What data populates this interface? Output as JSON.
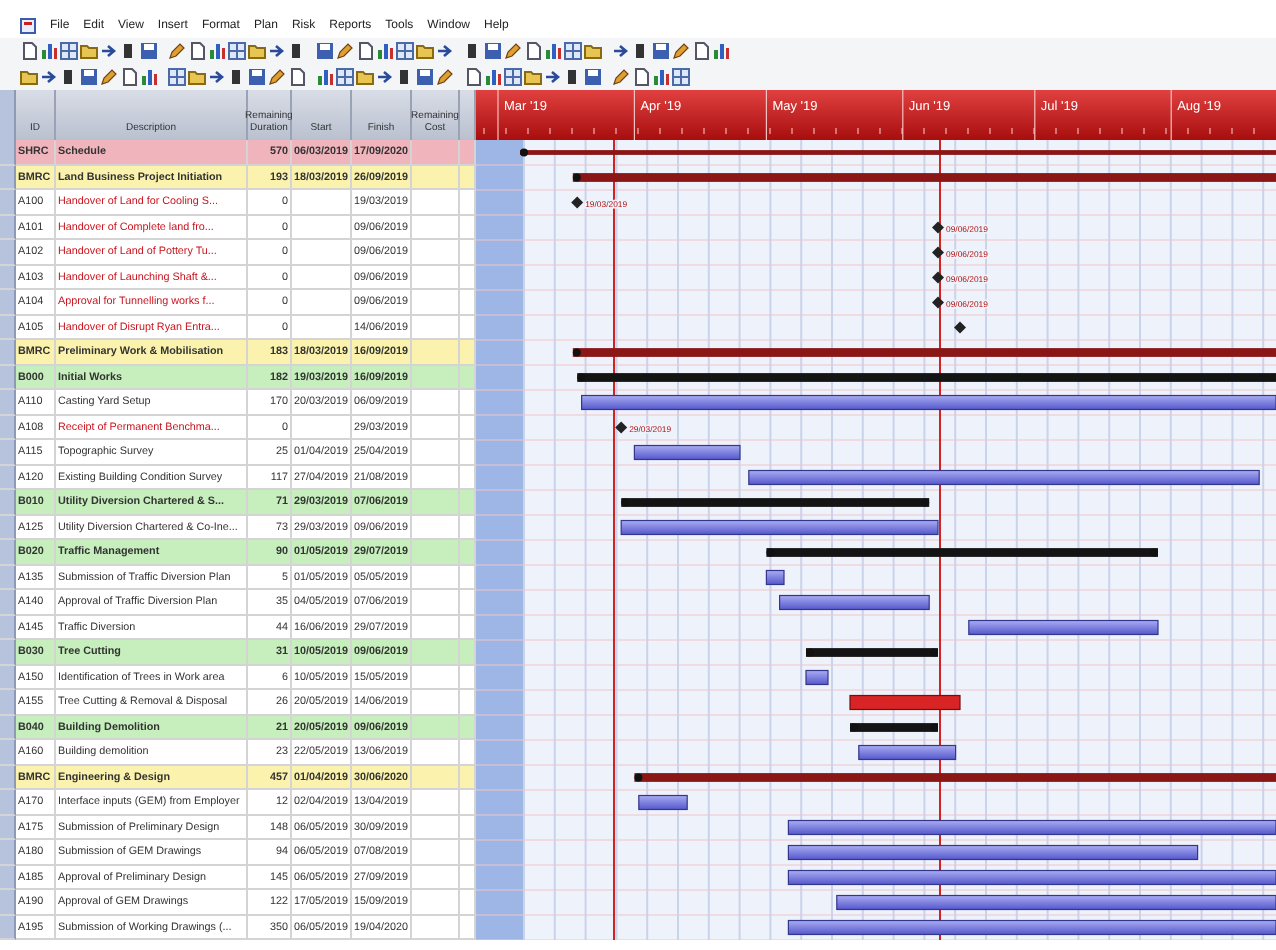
{
  "menu": [
    "File",
    "Edit",
    "View",
    "Insert",
    "Format",
    "Plan",
    "Risk",
    "Reports",
    "Tools",
    "Window",
    "Help"
  ],
  "columns": [
    "ID",
    "Description",
    "Remaining Duration",
    "Start",
    "Finish",
    "Remaining Cost"
  ],
  "timeline": {
    "months": [
      "Mar '19",
      "Apr '19",
      "May '19",
      "Jun '19",
      "Jul '19",
      "Aug '19"
    ]
  },
  "rows": [
    {
      "kind": "project",
      "id": "SHRC",
      "description": "Schedule",
      "duration": "570",
      "start": "06/03/2019",
      "finish": "17/09/2020"
    },
    {
      "kind": "phase",
      "id": "BMRC",
      "description": "Land Business Project Initiation",
      "duration": "193",
      "start": "18/03/2019",
      "finish": "26/09/2019"
    },
    {
      "kind": "milestone",
      "id": "A100",
      "description": "Handover of Land for Cooling S...",
      "duration": "0",
      "finish": "19/03/2019",
      "milestone_label": "19/03/2019"
    },
    {
      "kind": "milestone",
      "id": "A101",
      "description": "Handover of Complete land fro...",
      "duration": "0",
      "finish": "09/06/2019",
      "milestone_label": "09/06/2019"
    },
    {
      "kind": "milestone",
      "id": "A102",
      "description": "Handover of Land of Pottery Tu...",
      "duration": "0",
      "finish": "09/06/2019",
      "milestone_label": "09/06/2019"
    },
    {
      "kind": "milestone",
      "id": "A103",
      "description": "Handover of Launching Shaft &...",
      "duration": "0",
      "finish": "09/06/2019",
      "milestone_label": "09/06/2019"
    },
    {
      "kind": "milestone",
      "id": "A104",
      "description": "Approval for Tunnelling works f...",
      "duration": "0",
      "finish": "09/06/2019",
      "milestone_label": "09/06/2019"
    },
    {
      "kind": "milestone",
      "id": "A105",
      "description": "Handover of Disrupt Ryan Entra...",
      "duration": "0",
      "finish": "14/06/2019"
    },
    {
      "kind": "phase",
      "id": "BMRC",
      "description": "Preliminary Work & Mobilisation",
      "duration": "183",
      "start": "18/03/2019",
      "finish": "16/09/2019"
    },
    {
      "kind": "group",
      "id": "B000",
      "description": "Initial Works",
      "duration": "182",
      "start": "19/03/2019",
      "finish": "16/09/2019"
    },
    {
      "kind": "task",
      "id": "A110",
      "description": "Casting Yard Setup",
      "duration": "170",
      "start": "20/03/2019",
      "finish": "06/09/2019"
    },
    {
      "kind": "milestone",
      "id": "A108",
      "description": "Receipt of Permanent Benchma...",
      "duration": "0",
      "finish": "29/03/2019",
      "milestone_label": "29/03/2019"
    },
    {
      "kind": "task",
      "id": "A115",
      "description": "Topographic Survey",
      "duration": "25",
      "start": "01/04/2019",
      "finish": "25/04/2019"
    },
    {
      "kind": "task",
      "id": "A120",
      "description": "Existing Building Condition Survey",
      "duration": "117",
      "start": "27/04/2019",
      "finish": "21/08/2019"
    },
    {
      "kind": "group",
      "id": "B010",
      "description": "Utility Diversion Chartered & S...",
      "duration": "71",
      "start": "29/03/2019",
      "finish": "07/06/2019"
    },
    {
      "kind": "task",
      "id": "A125",
      "description": "Utility Diversion Chartered & Co-Ine...",
      "duration": "73",
      "start": "29/03/2019",
      "finish": "09/06/2019"
    },
    {
      "kind": "group",
      "id": "B020",
      "description": "Traffic Management",
      "duration": "90",
      "start": "01/05/2019",
      "finish": "29/07/2019"
    },
    {
      "kind": "task",
      "id": "A135",
      "description": "Submission of Traffic Diversion Plan",
      "duration": "5",
      "start": "01/05/2019",
      "finish": "05/05/2019"
    },
    {
      "kind": "task",
      "id": "A140",
      "description": "Approval of Traffic Diversion Plan",
      "duration": "35",
      "start": "04/05/2019",
      "finish": "07/06/2019"
    },
    {
      "kind": "task",
      "id": "A145",
      "description": "Traffic Diversion",
      "duration": "44",
      "start": "16/06/2019",
      "finish": "29/07/2019"
    },
    {
      "kind": "group",
      "id": "B030",
      "description": "Tree Cutting",
      "duration": "31",
      "start": "10/05/2019",
      "finish": "09/06/2019"
    },
    {
      "kind": "task",
      "id": "A150",
      "description": "Identification of Trees in Work area",
      "duration": "6",
      "start": "10/05/2019",
      "finish": "15/05/2019"
    },
    {
      "kind": "task",
      "id": "A155",
      "description": "Tree Cutting & Removal & Disposal",
      "duration": "26",
      "start": "20/05/2019",
      "finish": "14/06/2019",
      "critical": true
    },
    {
      "kind": "group",
      "id": "B040",
      "description": "Building Demolition",
      "duration": "21",
      "start": "20/05/2019",
      "finish": "09/06/2019"
    },
    {
      "kind": "task",
      "id": "A160",
      "description": "Building demolition",
      "duration": "23",
      "start": "22/05/2019",
      "finish": "13/06/2019"
    },
    {
      "kind": "phase",
      "id": "BMRC",
      "description": "Engineering & Design",
      "duration": "457",
      "start": "01/04/2019",
      "finish": "30/06/2020"
    },
    {
      "kind": "task",
      "id": "A170",
      "description": "Interface inputs (GEM) from Employer",
      "duration": "12",
      "start": "02/04/2019",
      "finish": "13/04/2019"
    },
    {
      "kind": "task",
      "id": "A175",
      "description": "Submission of Preliminary Design",
      "duration": "148",
      "start": "06/05/2019",
      "finish": "30/09/2019"
    },
    {
      "kind": "task",
      "id": "A180",
      "description": "Submission of GEM Drawings",
      "duration": "94",
      "start": "06/05/2019",
      "finish": "07/08/2019"
    },
    {
      "kind": "task",
      "id": "A185",
      "description": "Approval of Preliminary Design",
      "duration": "145",
      "start": "06/05/2019",
      "finish": "27/09/2019"
    },
    {
      "kind": "task",
      "id": "A190",
      "description": "Approval of GEM Drawings",
      "duration": "122",
      "start": "17/05/2019",
      "finish": "15/09/2019"
    },
    {
      "kind": "task",
      "id": "A195",
      "description": "Submission of Working Drawings (...",
      "duration": "350",
      "start": "06/05/2019",
      "finish": "19/04/2020"
    }
  ]
}
